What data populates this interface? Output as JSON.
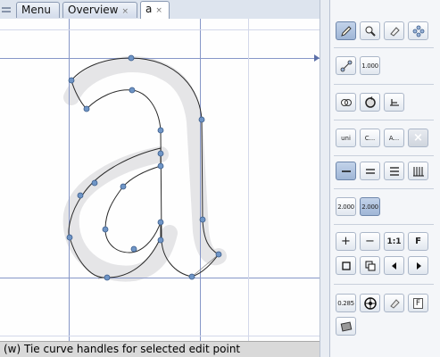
{
  "tabs": [
    {
      "label": "Menu"
    },
    {
      "label": "Overview",
      "close": "×"
    },
    {
      "label": "a",
      "close": "×"
    }
  ],
  "status": {
    "text": "(w) Tie curve handles for selected edit point"
  },
  "toolbox": {
    "draw_tools": [
      "pen-tool",
      "zoom-tool",
      "eraser-tool",
      "move-tool"
    ],
    "stroke": {
      "value": "1.000"
    },
    "paths": [
      "merge-paths",
      "reverse-direction",
      "baseline-align"
    ],
    "text_tools": {
      "unicode": "uni",
      "copy": "C...",
      "glyph": "A...",
      "delete": "×"
    },
    "align": [
      "align-left",
      "align-center",
      "align-right",
      "columns"
    ],
    "scale": {
      "x": "2.000",
      "y": "2.000"
    },
    "zoom": {
      "in": "+",
      "out": "−",
      "one_to_one": "1:1",
      "fit": "F"
    },
    "misc": [
      "square",
      "copy-layer",
      "previous",
      "next"
    ],
    "bottom": {
      "value": "0.285",
      "fullscreen_label": "F"
    }
  },
  "colors": {
    "accent": "#3a5a8c",
    "guide": "#7d8ec4",
    "outline": "#2c2c2c",
    "point": "#6f95c6",
    "status_bg": "#d9d9d9"
  }
}
